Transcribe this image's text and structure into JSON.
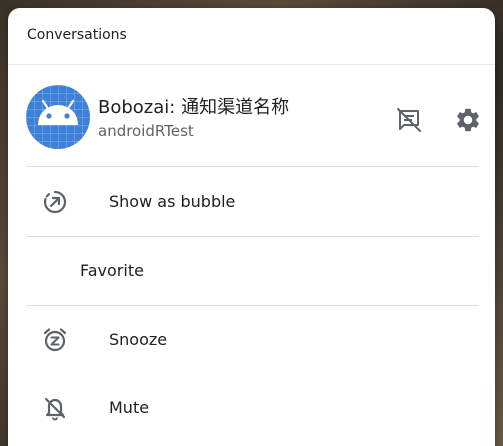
{
  "dialog": {
    "header_title": "Conversations",
    "app": {
      "name": "Bobozai: 通知渠道名称",
      "package": "androidRTest"
    },
    "menu": [
      {
        "label": "Show as bubble",
        "icon": "bubble-icon"
      },
      {
        "label": "Favorite",
        "icon": ""
      },
      {
        "label": "Snooze",
        "icon": "snooze-alarm-icon"
      },
      {
        "label": "Mute",
        "icon": "mute-bell-icon"
      }
    ]
  },
  "colors": {
    "avatar_blue": "#3d82d8",
    "icon_gray": "#5f6368",
    "text_primary": "#202124",
    "divider": "#dadce0"
  }
}
